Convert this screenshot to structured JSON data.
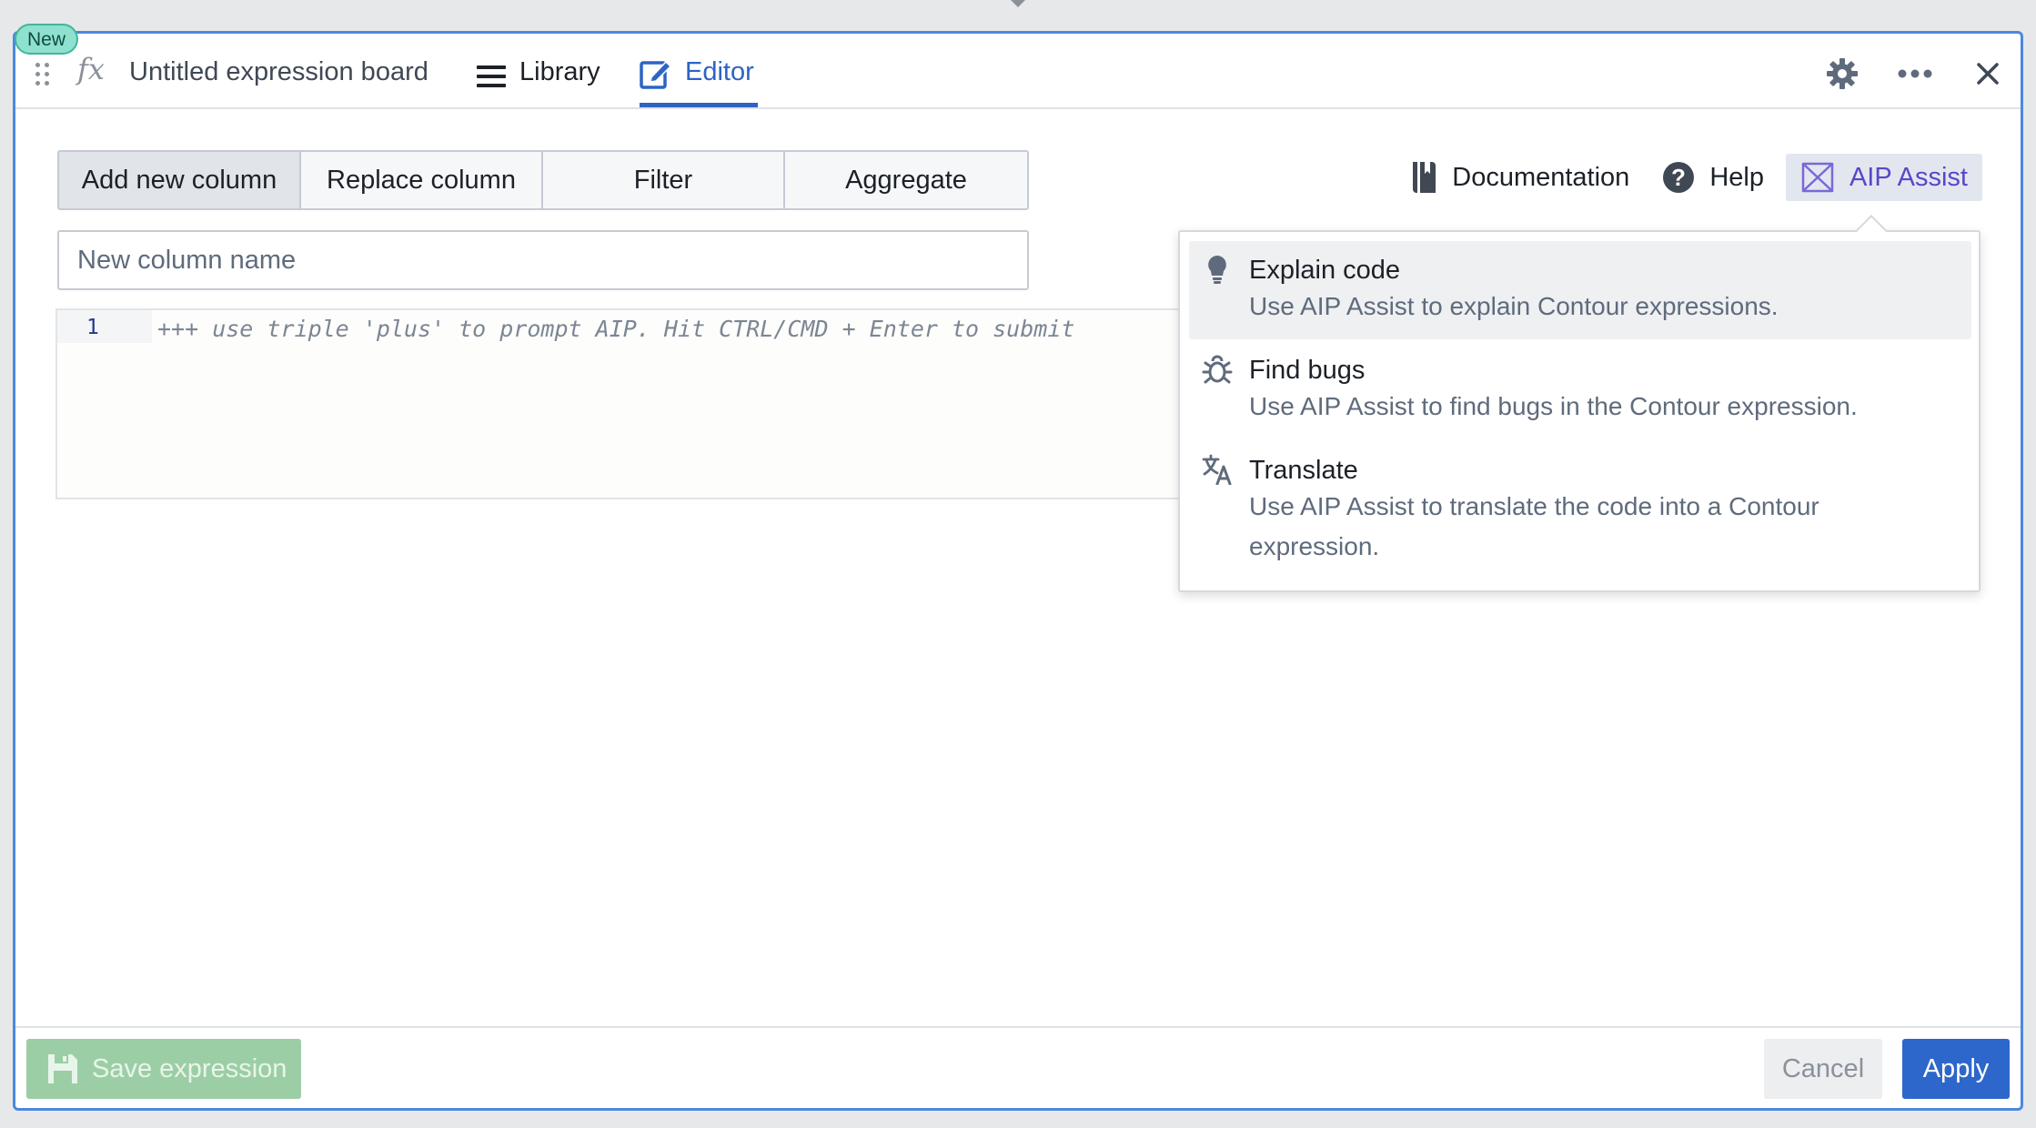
{
  "badge": {
    "new_label": "New"
  },
  "header": {
    "fx_symbol": "fx",
    "board_title": "Untitled expression board",
    "tabs": [
      {
        "label": "Library",
        "icon": "menu-icon"
      },
      {
        "label": "Editor",
        "icon": "edit-icon",
        "active": true
      }
    ],
    "icons": [
      "gear-icon",
      "more-icon",
      "close-icon"
    ]
  },
  "toolbar": {
    "modes": [
      "Add new column",
      "Replace column",
      "Filter",
      "Aggregate"
    ],
    "active_mode": "Add new column",
    "links": {
      "documentation": "Documentation",
      "help": "Help",
      "aip_assist": "AIP Assist"
    }
  },
  "column_name": {
    "placeholder": "New column name",
    "value": ""
  },
  "code_editor": {
    "line_number": "1",
    "placeholder": "+++ use triple 'plus' to prompt AIP. Hit CTRL/CMD + Enter to submit"
  },
  "aip_menu": {
    "items": [
      {
        "title": "Explain code",
        "description": "Use AIP Assist to explain Contour expressions.",
        "icon": "lightbulb-icon",
        "highlighted": true
      },
      {
        "title": "Find bugs",
        "description": "Use AIP Assist to find bugs in the Contour expression.",
        "icon": "bug-icon"
      },
      {
        "title": "Translate",
        "description": "Use AIP Assist to translate the code into a Contour expression.",
        "icon": "translate-icon"
      }
    ]
  },
  "footer": {
    "save_label": "Save expression",
    "cancel_label": "Cancel",
    "apply_label": "Apply"
  },
  "colors": {
    "accent": "#2d64c4",
    "aip": "#5a46c8",
    "apply": "#2d67cb",
    "save_disabled": "#9ccea6",
    "badge": "#8ee0cf"
  }
}
